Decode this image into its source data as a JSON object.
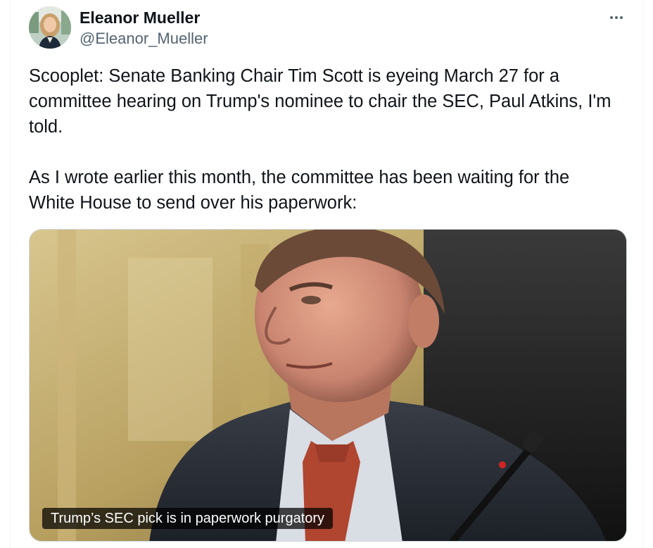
{
  "author": {
    "name": "Eleanor Mueller",
    "handle": "@Eleanor_Mueller"
  },
  "tweet": {
    "text": "Scooplet: Senate Banking Chair Tim Scott is eyeing March 27 for a\ncommittee hearing on Trump's nominee to chair the SEC, Paul Atkins, I'm\ntold.\n\nAs I wrote earlier this month, the committee has been waiting for the\nWhite House to send over his paperwork:"
  },
  "link_card": {
    "caption": "Trump’s SEC pick is in paperwork purgatory"
  },
  "icons": {
    "more": "more-options-icon"
  }
}
